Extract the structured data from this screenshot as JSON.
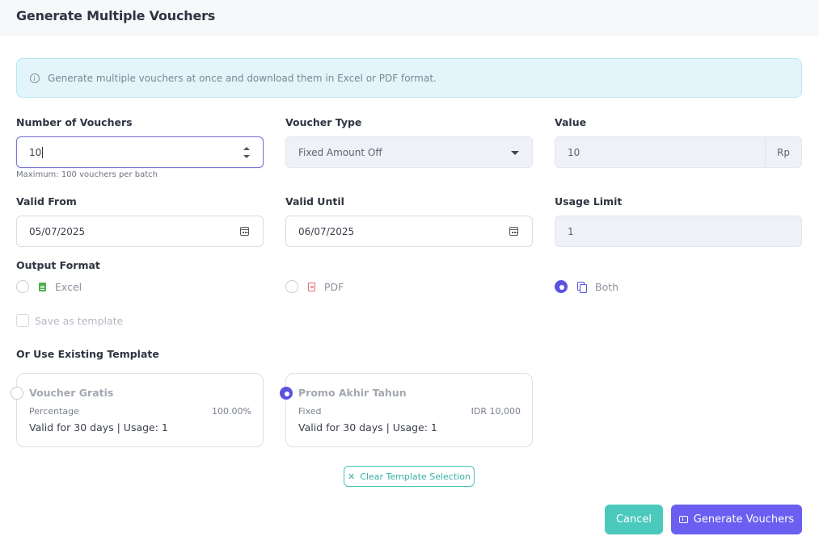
{
  "header": {
    "title": "Generate Multiple Vouchers"
  },
  "alert": {
    "icon": "info-icon",
    "message": "Generate multiple vouchers at once and download them in Excel or PDF format."
  },
  "fields": {
    "number_of_vouchers": {
      "label": "Number of Vouchers",
      "value": "10",
      "hint": "Maximum: 100 vouchers per batch"
    },
    "voucher_type": {
      "label": "Voucher Type",
      "value": "Fixed Amount Off"
    },
    "value": {
      "label": "Value",
      "value": "10",
      "suffix": "Rp"
    },
    "valid_from": {
      "label": "Valid From",
      "value": "05/07/2025"
    },
    "valid_until": {
      "label": "Valid Until",
      "value": "06/07/2025"
    },
    "usage_limit": {
      "label": "Usage Limit",
      "value": "1"
    }
  },
  "output_format": {
    "label": "Output Format",
    "options": [
      {
        "label": "Excel",
        "icon": "excel-file-icon",
        "checked": false
      },
      {
        "label": "PDF",
        "icon": "pdf-file-icon",
        "checked": false
      },
      {
        "label": "Both",
        "icon": "copy-icon",
        "checked": true
      }
    ]
  },
  "save_template": {
    "label": "Save as template",
    "checked": false
  },
  "templates": {
    "label": "Or Use Existing Template",
    "items": [
      {
        "title": "Voucher Gratis",
        "type": "Percentage",
        "value": "100.00%",
        "description": "Valid for 30 days | Usage: 1",
        "selected": false
      },
      {
        "title": "Promo Akhir Tahun",
        "type": "Fixed",
        "value": "IDR 10,000",
        "description": "Valid for 30 days | Usage: 1",
        "selected": true
      }
    ],
    "clear_label": "Clear Template Selection"
  },
  "actions": {
    "cancel_label": "Cancel",
    "generate_label": "Generate Vouchers"
  },
  "colors": {
    "primary": "#6a5ff0",
    "teal": "#4cc9bd",
    "alert_bg": "#e3f5fa"
  }
}
